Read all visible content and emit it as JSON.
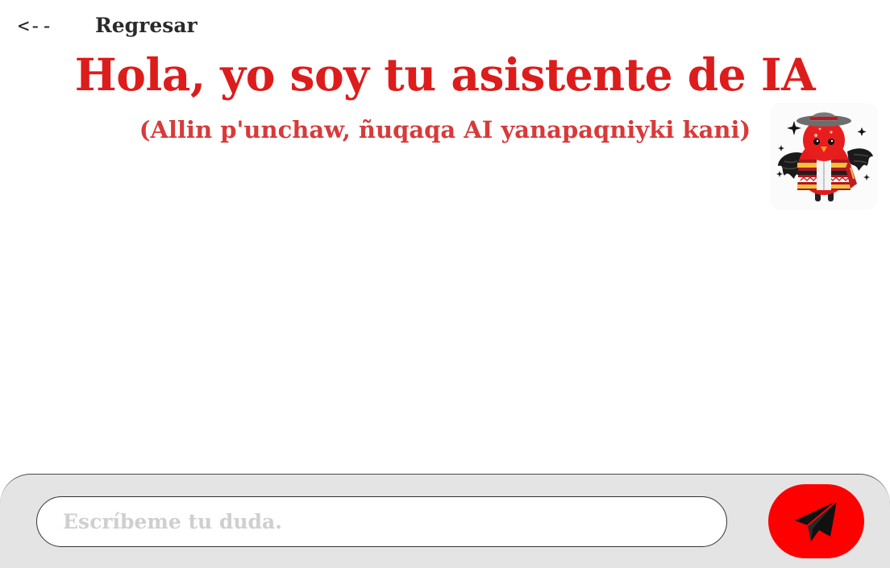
{
  "header": {
    "back_arrow": "<--",
    "back_label": "Regresar",
    "title": "Hola, yo soy tu asistente de IA",
    "subtitle": "(Allin p'unchaw, ñuqaqa AI yanapaqniyki kani)"
  },
  "composer": {
    "placeholder": "Escríbeme tu duda.",
    "value": ""
  },
  "icons": {
    "send": "paper-plane-icon",
    "avatar": "assistant-bird-mascot"
  },
  "colors": {
    "accent": "#fe0000",
    "title": "#dd1c1c",
    "subtitle": "#d83a3a",
    "composer_bg": "#e4e4e4"
  }
}
